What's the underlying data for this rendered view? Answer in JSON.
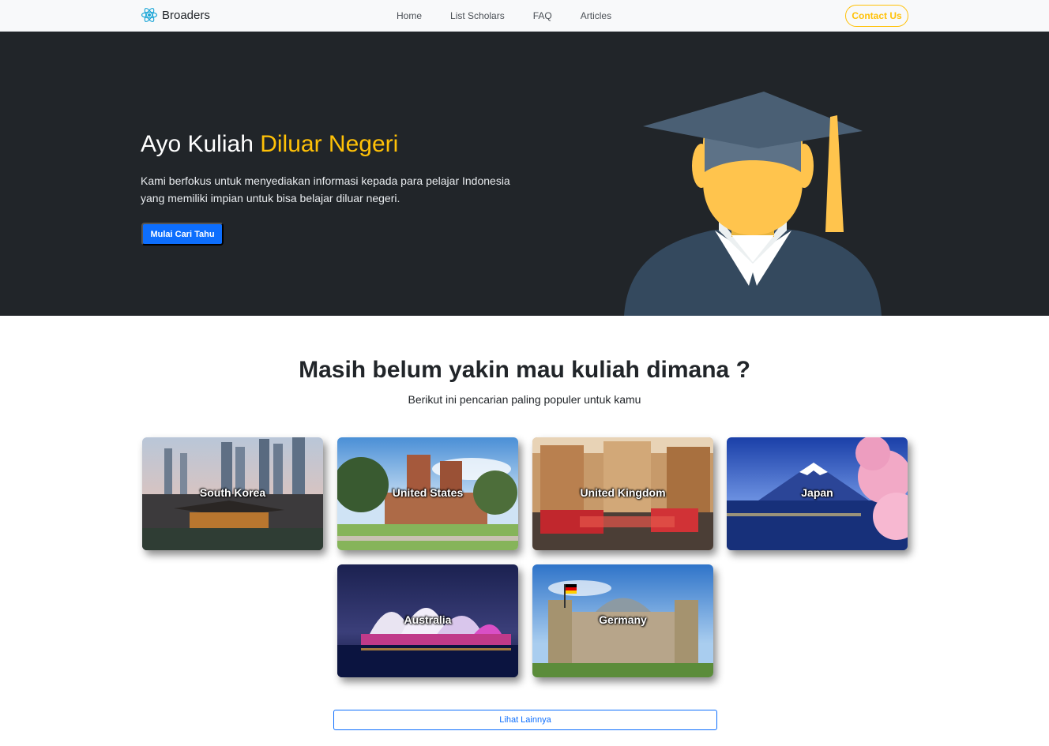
{
  "brand": {
    "name": "Broaders",
    "icon": "react-atom-icon"
  },
  "nav": {
    "links": [
      "Home",
      "List Scholars",
      "FAQ",
      "Articles"
    ],
    "contact_label": "Contact Us"
  },
  "hero": {
    "title_main": "Ayo Kuliah ",
    "title_accent": "Diluar Negeri",
    "description": "Kami berfokus untuk menyediakan informasi kepada para pelajar Indonesia yang memiliki impian untuk bisa belajar diluar negeri.",
    "cta_label": "Mulai Cari Tahu",
    "illustration": "graduate-icon"
  },
  "section": {
    "title": "Masih belum yakin mau kuliah dimana ?",
    "subtitle": "Berikut ini pencarian paling populer untuk kamu"
  },
  "destinations": [
    {
      "name": "South Korea"
    },
    {
      "name": "United States"
    },
    {
      "name": "United Kingdom"
    },
    {
      "name": "Japan"
    },
    {
      "name": "Australia"
    },
    {
      "name": "Germany"
    }
  ],
  "more_label": "Lihat Lainnya",
  "colors": {
    "primary": "#0d6efd",
    "accent": "#ffc107",
    "hero_bg": "#212529",
    "navbar_bg": "#f8f9fa"
  }
}
